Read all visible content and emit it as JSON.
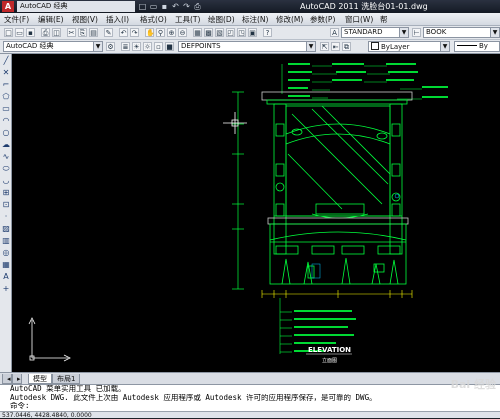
{
  "titlebar": {
    "logo": "A",
    "workspace": "AutoCAD 经典",
    "app_title": "AutoCAD 2011   洗脸台01-01.dwg"
  },
  "menu": [
    "文件(F)",
    "编辑(E)",
    "视图(V)",
    "插入(I)",
    "格式(O)",
    "工具(T)",
    "绘图(D)",
    "标注(N)",
    "修改(M)",
    "参数(P)",
    "窗口(W)",
    "帮"
  ],
  "toolbar": {
    "textstyle": "STANDARD",
    "dimstyle": "BOOK",
    "workspace_combo": "AutoCAD 经典",
    "layer": "DEFPOINTS",
    "color": "ByLayer",
    "linetype": "By"
  },
  "drawing": {
    "title": "ELEVATION",
    "subtitle": "立面图"
  },
  "tabs": [
    "模型",
    "布局1"
  ],
  "command": {
    "lines": [
      "AutoCAD 菜单实用工具 已加载。",
      "Autodesk DWG.  此文件上次由 Autodesk 应用程序或 Autodesk 许可的应用程序保存，是可靠的 DWG。",
      "命令:"
    ]
  },
  "status": {
    "coords": "537.0446,  4428.4840,  0.0000"
  },
  "watermark": "Bai 经验",
  "colors": {
    "canvas": "#000000",
    "linework": "#00ff3c",
    "dims": "#ffff00",
    "text": "#ffffff"
  }
}
